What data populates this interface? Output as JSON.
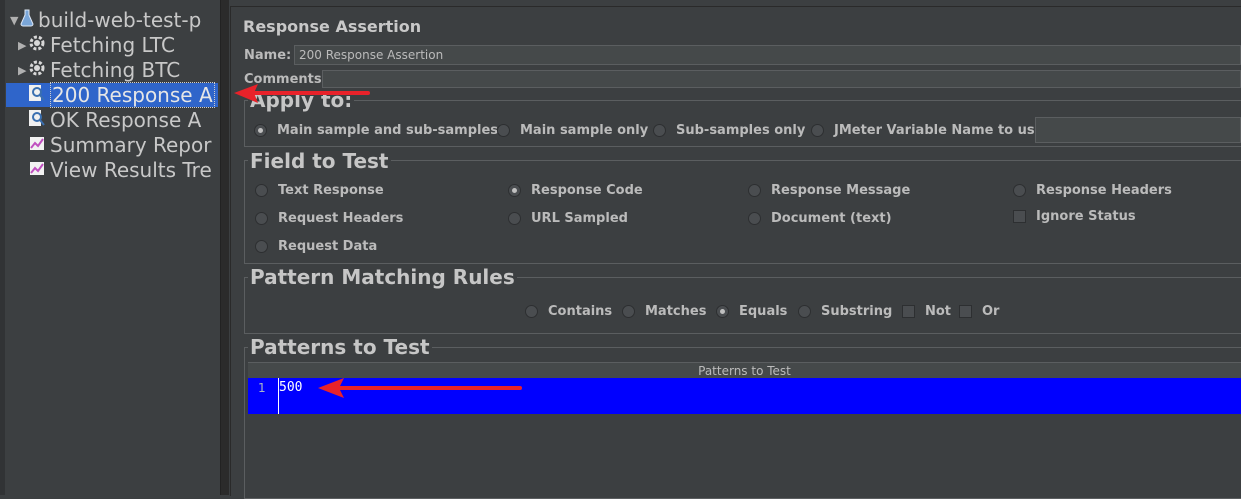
{
  "tree": {
    "root": "build-web-test-p",
    "items": [
      {
        "label": "Fetching LTC"
      },
      {
        "label": "Fetching BTC"
      },
      {
        "label": "200 Response A"
      },
      {
        "label": "OK  Response A"
      },
      {
        "label": "Summary Repor"
      },
      {
        "label": "View Results Tre"
      }
    ]
  },
  "panel": {
    "title": "Response Assertion",
    "name_label": "Name:",
    "name_value": "200 Response Assertion",
    "comments_label": "Comments:"
  },
  "apply_to": {
    "title": "Apply to:",
    "options": [
      "Main sample and sub-samples",
      "Main sample only",
      "Sub-samples only",
      "JMeter Variable Name to use"
    ],
    "selected": "Main sample and sub-samples"
  },
  "field_to_test": {
    "title": "Field to Test",
    "options": [
      "Text Response",
      "Response Code",
      "Response Message",
      "Response Headers",
      "Request Headers",
      "URL Sampled",
      "Document (text)",
      "Request Data"
    ],
    "ignore_status": "Ignore Status",
    "selected": "Response Code"
  },
  "pattern_rules": {
    "title": "Pattern Matching Rules",
    "options": [
      "Contains",
      "Matches",
      "Equals",
      "Substring"
    ],
    "checks": [
      "Not",
      "Or"
    ],
    "selected": "Equals"
  },
  "patterns": {
    "title": "Patterns to Test",
    "column": "Patterns to Test",
    "rows": [
      {
        "num": "1",
        "value": "500"
      }
    ]
  },
  "colors": {
    "selection": "#2f65ca",
    "pattern_bg": "#0000ff",
    "arrow": "#e8222a"
  }
}
